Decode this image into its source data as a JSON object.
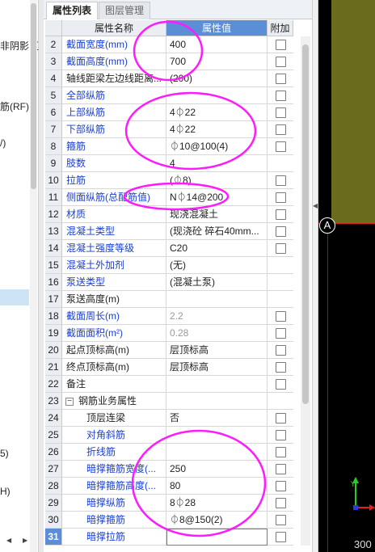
{
  "tabs": [
    "属性列表",
    "图层管理"
  ],
  "headers": {
    "name": "属性名称",
    "value": "属性值",
    "extra": "附加"
  },
  "left_fragments": [
    "非阴影区",
    "筋(RF)",
    "/)",
    "5)",
    "H)"
  ],
  "rows": [
    {
      "num": "2",
      "name": "截面宽度(mm)",
      "value": "400",
      "color": "blue",
      "checkbox": true
    },
    {
      "num": "3",
      "name": "截面高度(mm)",
      "value": "700",
      "color": "blue",
      "checkbox": true
    },
    {
      "num": "4",
      "name": "轴线距梁左边线距离...",
      "value": "(200)",
      "color": "black",
      "checkbox": true
    },
    {
      "num": "5",
      "name": "全部纵筋",
      "value": "",
      "color": "blue",
      "checkbox": true
    },
    {
      "num": "6",
      "name": "上部纵筋",
      "value": "4⏀22",
      "color": "blue",
      "checkbox": true
    },
    {
      "num": "7",
      "name": "下部纵筋",
      "value": "4⏀22",
      "color": "blue",
      "checkbox": true
    },
    {
      "num": "8",
      "name": "箍筋",
      "value": "⏀10@100(4)",
      "color": "blue",
      "checkbox": true
    },
    {
      "num": "9",
      "name": "肢数",
      "value": "4",
      "color": "blue",
      "checkbox": false
    },
    {
      "num": "10",
      "name": "拉筋",
      "value": "(⏀8)",
      "color": "blue",
      "checkbox": true
    },
    {
      "num": "11",
      "name": "侧面纵筋(总配筋值)",
      "value": "N⏀14@200",
      "color": "blue",
      "checkbox": true
    },
    {
      "num": "12",
      "name": "材质",
      "value": "现浇混凝土",
      "color": "blue",
      "checkbox": true
    },
    {
      "num": "13",
      "name": "混凝土类型",
      "value": "(现浇砼 碎石40mm...",
      "color": "blue",
      "checkbox": true
    },
    {
      "num": "14",
      "name": "混凝土强度等级",
      "value": "C20",
      "color": "blue",
      "checkbox": true
    },
    {
      "num": "15",
      "name": "混凝土外加剂",
      "value": "(无)",
      "color": "blue",
      "checkbox": false
    },
    {
      "num": "16",
      "name": "泵送类型",
      "value": "(混凝土泵)",
      "color": "blue",
      "checkbox": false
    },
    {
      "num": "17",
      "name": "泵送高度(m)",
      "value": "",
      "color": "black",
      "checkbox": false
    },
    {
      "num": "18",
      "name": "截面周长(m)",
      "value": "2.2",
      "color": "blue",
      "value_gray": true,
      "checkbox": true
    },
    {
      "num": "19",
      "name": "截面面积(m²)",
      "value": "0.28",
      "color": "blue",
      "value_gray": true,
      "checkbox": true
    },
    {
      "num": "20",
      "name": "起点顶标高(m)",
      "value": "层顶标高",
      "color": "black",
      "checkbox": true
    },
    {
      "num": "21",
      "name": "终点顶标高(m)",
      "value": "层顶标高",
      "color": "black",
      "checkbox": true
    },
    {
      "num": "22",
      "name": "备注",
      "value": "",
      "color": "black",
      "checkbox": true
    },
    {
      "num": "23",
      "name": "钢筋业务属性",
      "value": "",
      "color": "black",
      "group": true,
      "expander": "−",
      "checkbox": false
    },
    {
      "num": "24",
      "name": "顶层连梁",
      "value": "否",
      "color": "black",
      "indent": true,
      "checkbox": true
    },
    {
      "num": "25",
      "name": "对角斜筋",
      "value": "",
      "color": "blue",
      "indent": true,
      "checkbox": true
    },
    {
      "num": "26",
      "name": "折线筋",
      "value": "",
      "color": "blue",
      "indent": true,
      "checkbox": true
    },
    {
      "num": "27",
      "name": "暗撑箍筋宽度(...",
      "value": "250",
      "color": "blue",
      "indent": true,
      "checkbox": true
    },
    {
      "num": "28",
      "name": "暗撑箍筋高度(...",
      "value": "80",
      "color": "blue",
      "indent": true,
      "checkbox": true
    },
    {
      "num": "29",
      "name": "暗撑纵筋",
      "value": "8⏀28",
      "color": "blue",
      "indent": true,
      "checkbox": true
    },
    {
      "num": "30",
      "name": "暗撑箍筋",
      "value": "⏀8@150(2)",
      "color": "blue",
      "indent": true,
      "checkbox": true
    },
    {
      "num": "31",
      "name": "暗撑拉筋",
      "value": "",
      "color": "blue",
      "indent": true,
      "active": true,
      "checkbox": true
    }
  ],
  "canvas": {
    "axis_label": "A",
    "scale_text": "300"
  },
  "colors": {
    "header_accent": "#5b8ed6",
    "blue_label": "#1a3fd0",
    "annotation": "#ff1aff",
    "canvas_bg": "#000000",
    "olive": "#6b6b1e"
  }
}
